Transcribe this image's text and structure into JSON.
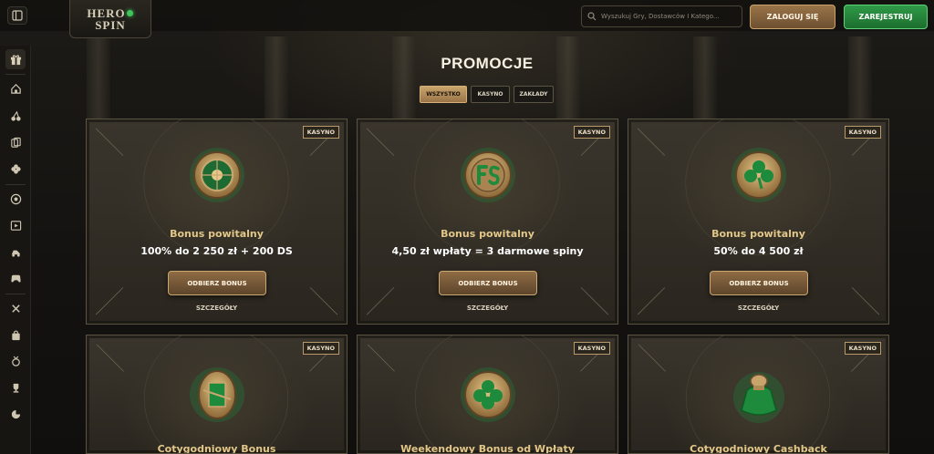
{
  "header": {
    "logo_line1": "HERO",
    "logo_line2": "SPIN",
    "search_placeholder": "Wyszukuj Gry, Dostawców I Katego...",
    "login_label": "ZALOGUJ SIĘ",
    "register_label": "ZAREJESTRUJ"
  },
  "colors": {
    "accent_gold": "#c9a46b",
    "accent_green": "#2f9a47",
    "card_title": "#e2c789"
  },
  "sidebar": {
    "items": [
      {
        "icon": "gift-icon",
        "active": true
      },
      {
        "icon": "home-icon"
      },
      {
        "icon": "cherry-icon"
      },
      {
        "icon": "cards-icon"
      },
      {
        "icon": "clover-icon"
      },
      {
        "icon": "football-icon"
      },
      {
        "icon": "live-icon"
      },
      {
        "icon": "racing-icon"
      },
      {
        "icon": "gamepad-icon"
      },
      {
        "icon": "tools-icon"
      },
      {
        "icon": "shop-icon"
      },
      {
        "icon": "medal-icon"
      },
      {
        "icon": "trophy-icon"
      },
      {
        "icon": "coin-icon"
      }
    ]
  },
  "page": {
    "title": "PROMOCJE",
    "filters": [
      "WSZYSTKO",
      "KASYNO",
      "ZAKŁADY"
    ]
  },
  "cards": [
    {
      "badge": "KASYNO",
      "title": "Bonus powitalny",
      "subtitle": "100% do 2 250 zł + 200 DS",
      "cta": "ODBIERZ BONUS",
      "details": "SZCZEGÓŁY",
      "icon": "roulette-coin-icon"
    },
    {
      "badge": "KASYNO",
      "title": "Bonus powitalny",
      "subtitle": "4,50 zł wpłaty = 3 darmowe spiny",
      "cta": "ODBIERZ BONUS",
      "details": "SZCZEGÓŁY",
      "icon": "fs-coin-icon"
    },
    {
      "badge": "KASYNO",
      "title": "Bonus powitalny",
      "subtitle": "50% do 4 500 zł",
      "cta": "ODBIERZ BONUS",
      "details": "SZCZEGÓŁY",
      "icon": "clover-coin-icon"
    },
    {
      "badge": "KASYNO",
      "title": "Cotygodniowy Bonus",
      "icon": "gift-coin-icon"
    },
    {
      "badge": "KASYNO",
      "title": "Weekendowy Bonus od Wpłaty",
      "icon": "clover-coin-icon"
    },
    {
      "badge": "KASYNO",
      "title": "Cotygodniowy Cashback",
      "icon": "money-bag-icon"
    }
  ]
}
